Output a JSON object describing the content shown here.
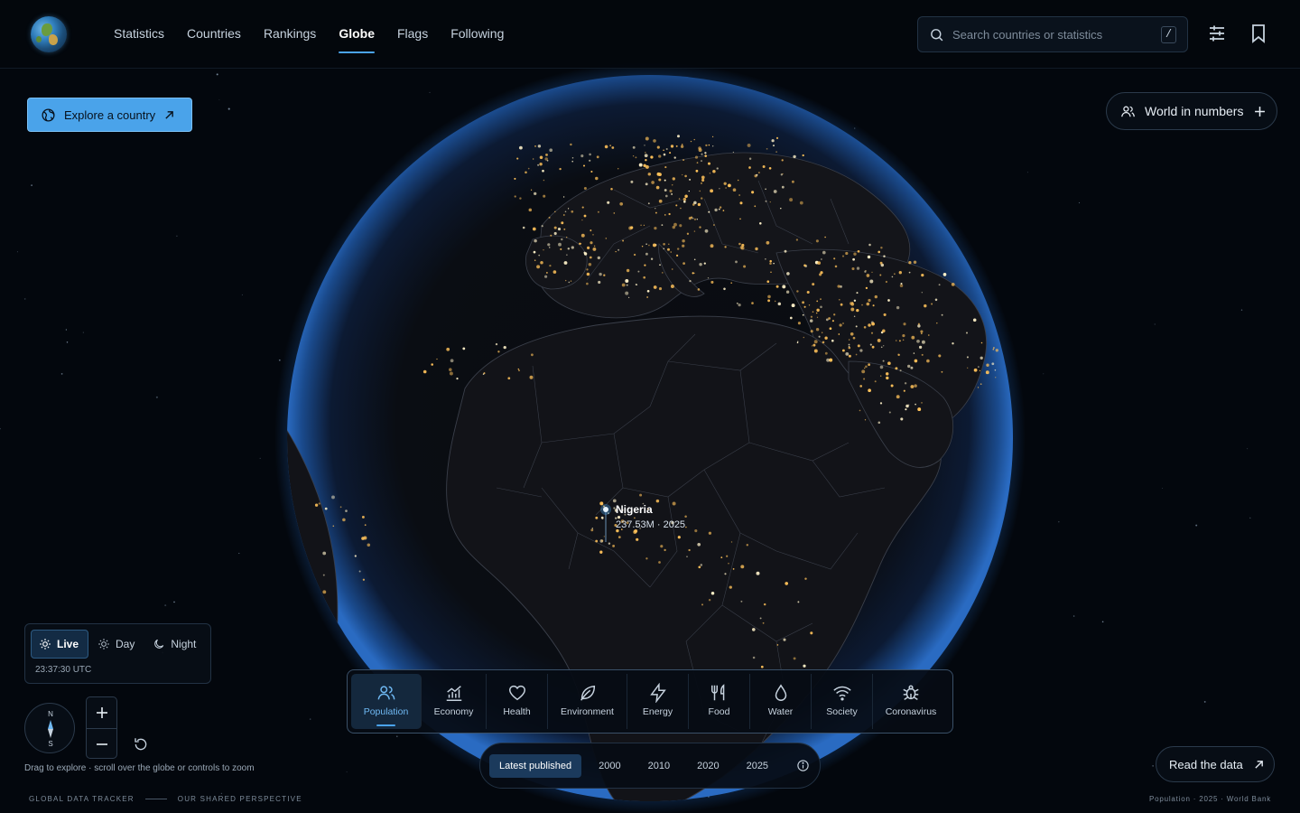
{
  "nav": {
    "items": [
      {
        "label": "Statistics",
        "active": false
      },
      {
        "label": "Countries",
        "active": false
      },
      {
        "label": "Rankings",
        "active": false
      },
      {
        "label": "Globe",
        "active": true
      },
      {
        "label": "Flags",
        "active": false
      },
      {
        "label": "Following",
        "active": false
      }
    ]
  },
  "search": {
    "placeholder": "Search countries or statistics",
    "shortcut": "/"
  },
  "header_icons": [
    "sliders-icon",
    "bookmark-icon"
  ],
  "explore_button": {
    "label": "Explore a country",
    "icon": "globe-icon"
  },
  "world_in_numbers": {
    "label": "World in numbers",
    "icon": "users-icon"
  },
  "globe": {
    "marker": {
      "country": "Nigeria",
      "value": "237.53M · 2025"
    }
  },
  "time_mode": {
    "options": [
      {
        "label": "Live",
        "icon": "sun-icon",
        "active": true
      },
      {
        "label": "Day",
        "icon": "sun-outline-icon",
        "active": false
      },
      {
        "label": "Night",
        "icon": "moon-icon",
        "active": false
      }
    ],
    "clock": "23:37:30 UTC"
  },
  "compass": {
    "north": "N",
    "south": "S"
  },
  "hint": "Drag to explore · scroll over the globe or controls to zoom",
  "footer_left": {
    "a": "GLOBAL DATA TRACKER",
    "b": "OUR SHARED PERSPECTIVE"
  },
  "footer_right": "Population · 2025 · World Bank",
  "categories": [
    {
      "label": "Population",
      "icon": "users-icon",
      "active": true
    },
    {
      "label": "Economy",
      "icon": "chart-icon",
      "active": false
    },
    {
      "label": "Health",
      "icon": "heart-icon",
      "active": false
    },
    {
      "label": "Environment",
      "icon": "leaf-icon",
      "active": false
    },
    {
      "label": "Energy",
      "icon": "bolt-icon",
      "active": false
    },
    {
      "label": "Food",
      "icon": "utensils-icon",
      "active": false
    },
    {
      "label": "Water",
      "icon": "droplet-icon",
      "active": false
    },
    {
      "label": "Society",
      "icon": "wifi-icon",
      "active": false
    },
    {
      "label": "Coronavirus",
      "icon": "virus-icon",
      "active": false
    }
  ],
  "years": [
    {
      "label": "Latest published",
      "active": true
    },
    {
      "label": "2000",
      "active": false
    },
    {
      "label": "2010",
      "active": false
    },
    {
      "label": "2020",
      "active": false
    },
    {
      "label": "2025",
      "active": false
    }
  ],
  "read_data": {
    "label": "Read the data"
  },
  "colors": {
    "accent": "#4aa3ea",
    "background": "#03070d",
    "city_lights": "#ffc25a",
    "atmosphere": "#1e5aa8"
  }
}
